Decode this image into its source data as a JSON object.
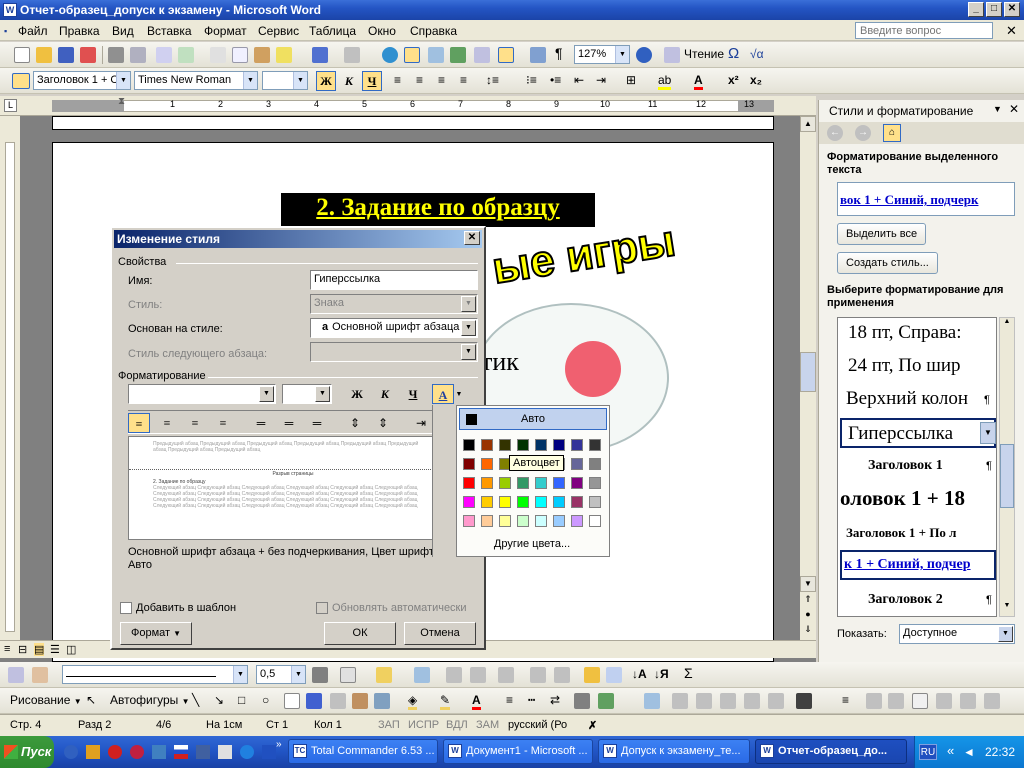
{
  "window": {
    "title": "Отчет-образец_допуск к экзамену - Microsoft Word",
    "app_icon": "W"
  },
  "menu": {
    "items": [
      "Файл",
      "Правка",
      "Вид",
      "Вставка",
      "Формат",
      "Сервис",
      "Таблица",
      "Окно",
      "Справка"
    ],
    "ask_placeholder": "Введите вопрос"
  },
  "toolbar_standard": {
    "zoom": "127%",
    "reading_label": "Чтение"
  },
  "toolbar_format": {
    "style": "Заголовок 1 + С",
    "font": "Times New Roman",
    "bold": "Ж",
    "italic": "К",
    "underline": "Ч"
  },
  "ruler": {
    "marks": [
      "1",
      "2",
      "3",
      "4",
      "5",
      "6",
      "7",
      "8",
      "9",
      "10",
      "11",
      "12",
      "13"
    ]
  },
  "document": {
    "heading": "2. Задание по образцу",
    "wordart": "ые игры",
    "visible_fragment": "тик"
  },
  "dialog": {
    "title": "Изменение стиля",
    "section_properties": "Свойства",
    "name_label": "Имя:",
    "name_value": "Гиперссылка",
    "style_label": "Стиль:",
    "style_value": "Знака",
    "based_label": "Основан на стиле:",
    "based_icon": "a",
    "based_value": "Основной шрифт абзаца",
    "next_label": "Стиль следующего абзаца:",
    "section_format": "Форматирование",
    "bold": "Ж",
    "italic": "К",
    "underline": "Ч",
    "font_color_letter": "A",
    "preview_before": "Предыдущий абзац Предыдущий абзац Предыдущий абзац Предыдущий абзац Предыдущий абзац Предыдущий абзац Предыдущий абзац Предыдущий абзац",
    "preview_break": "Разрыв страницы",
    "preview_sample": "2. Задание по образцу",
    "preview_after": "Следующий абзац Следующий абзац Следующий абзац Следующий абзац Следующий абзац Следующий абзац Следующий абзац Следующий абзац Следующий абзац Следующий абзац Следующий абзац Следующий абзац Следующий абзац Следующий абзац Следующий абзац Следующий абзац Следующий абзац Следующий абзац Следующий абзац Следующий абзац Следующий абзац Следующий абзац Следующий абзац Следующий абзац",
    "description": "Основной шрифт абзаца + без подчеркивания, Цвет шрифта: Авто",
    "add_template": "Добавить в шаблон",
    "auto_update": "Обновлять автоматически",
    "format_button": "Формат",
    "ok": "ОК",
    "cancel": "Отмена"
  },
  "color_popup": {
    "auto_label": "Авто",
    "tooltip": "Автоцвет",
    "more_colors": "Другие цвета...",
    "colors": [
      [
        "#000000",
        "#993300",
        "#333300",
        "#003300",
        "#003366",
        "#000080",
        "#333399",
        "#333333"
      ],
      [
        "#800000",
        "#ff6600",
        "#808000",
        "#008000",
        "#008080",
        "#0000ff",
        "#666699",
        "#808080"
      ],
      [
        "#ff0000",
        "#ff9900",
        "#99cc00",
        "#339966",
        "#33cccc",
        "#3366ff",
        "#800080",
        "#969696"
      ],
      [
        "#ff00ff",
        "#ffcc00",
        "#ffff00",
        "#00ff00",
        "#00ffff",
        "#00ccff",
        "#993366",
        "#c0c0c0"
      ],
      [
        "#ff99cc",
        "#ffcc99",
        "#ffff99",
        "#ccffcc",
        "#ccffff",
        "#99ccff",
        "#cc99ff",
        "#ffffff"
      ]
    ]
  },
  "taskpane": {
    "title": "Стили и форматирование",
    "selected_label": "Форматирование выделенного текста",
    "selected_value": "вок 1 + Синий, подчерк",
    "select_all": "Выделить все",
    "create_style": "Создать стиль...",
    "choose_label": "Выберите форматирование для применения",
    "styles": [
      "18 пт, Справа:",
      "24 пт, По шир",
      "Верхний колон",
      "Гиперссылка",
      "Заголовок 1",
      "оловок 1 + 18",
      "Заголовок 1 + По л",
      "к 1 + Синий, подчер",
      "Заголовок 2"
    ],
    "show_label": "Показать:",
    "show_value": "Доступное"
  },
  "drawing_toolbar": {
    "draw_label": "Рисование",
    "autoshapes_label": "Автофигуры",
    "line_width": "0,5"
  },
  "status": {
    "page": "Стр. 4",
    "section": "Разд 2",
    "pages": "4/6",
    "at": "На 1см",
    "line": "Ст 1",
    "col": "Кол 1",
    "rec": "ЗАП",
    "trk": "ИСПР",
    "ext": "ВДЛ",
    "ovr": "ЗАМ",
    "lang": "русский (Ро"
  },
  "taskbar": {
    "start": "Пуск",
    "items": [
      "Total Commander 6.53 ...",
      "Документ1 - Microsoft ...",
      "Допуск к экзамену_те...",
      "Отчет-образец_до..."
    ],
    "lang": "RU",
    "time": "22:32"
  },
  "colors": {
    "title_blue": "#2455c4",
    "heading_bg": "#000000",
    "heading_fg": "#ffff00",
    "hyperlink": "#0000cc"
  }
}
